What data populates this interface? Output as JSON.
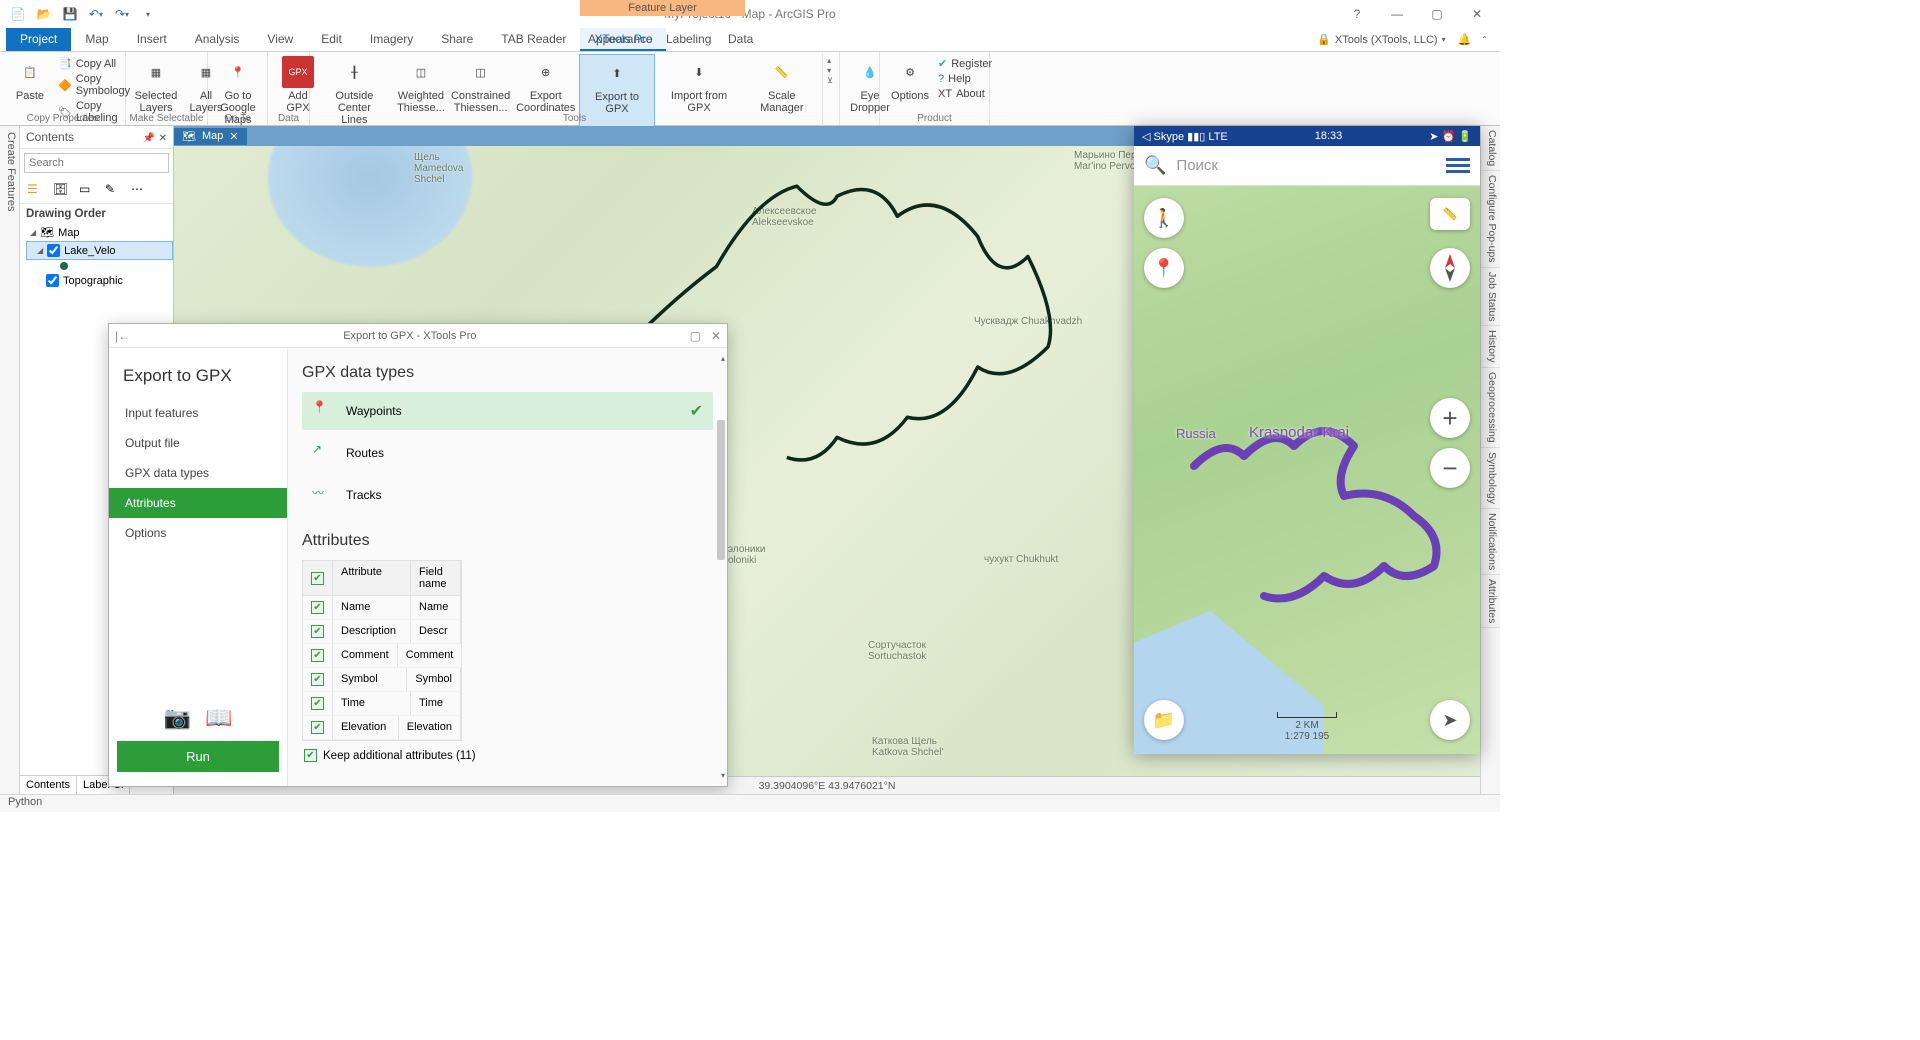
{
  "title": "MyProject10 - Map - ArcGIS Pro",
  "context_tab": "Feature Layer",
  "signin": "XTools (XTools, LLC) ",
  "ribbon_tabs": [
    "Project",
    "Map",
    "Insert",
    "Analysis",
    "View",
    "Edit",
    "Imagery",
    "Share",
    "TAB Reader",
    "XTools Pro",
    "Appearance",
    "Labeling",
    "Data"
  ],
  "ribbon": {
    "paste": "Paste",
    "copy_all": "Copy All",
    "copy_symbology": "Copy Symbology",
    "copy_labeling": "Copy Labeling",
    "copy_props_group": "Copy Properties",
    "selected_layers": "Selected\nLayers",
    "all_layers": "All\nLayers",
    "make_selectable_group": "Make Selectable",
    "goto_google": "Go to Google\nMaps ",
    "goto_group": "Go To",
    "add_gpx": "Add\nGPX",
    "data_group": "Data",
    "outside_center": "Outside Center\nLines",
    "weighted": "Weighted\nThiesse...",
    "constrained": "Constrained\nThiessen...",
    "export_coords": "Export\nCoordinates",
    "export_gpx": "Export to GPX",
    "import_gpx": "Import from GPX",
    "scale_mgr": "Scale Manager",
    "tools_group": "Tools",
    "eye_dropper": "Eye\nDropper",
    "options": "Options",
    "register": "Register",
    "help": "Help",
    "about": "About",
    "product_group": "Product"
  },
  "contents": {
    "title": "Contents",
    "search_ph": "Search",
    "drawing_order": "Drawing Order",
    "map": "Map",
    "layer1": "Lake_Velo",
    "layer2": "Topographic",
    "tab1": "Contents",
    "tab2": "Label Cl"
  },
  "left_vtab": "Create Features",
  "right_vtabs": [
    "Catalog",
    "Configure Pop-ups",
    "Job Status",
    "History",
    "Geoprocessing",
    "Symbology",
    "Notifications",
    "Attributes"
  ],
  "map_tab": "Map",
  "map_labels": {
    "shchel": "Щель\nMamedova\nShchel",
    "alekseevskoe": "Алексеевское\nAlekseevskoe",
    "marino": "Марьино Первое\nMar'ino Pervoe",
    "chuakh": "Чусквадж Chuakhvadzh",
    "soloniki": "элоники\noloniki",
    "chukhukt": "чухукт Chukhukt",
    "sortu": "Сортучасток\nSortuchastok",
    "katkova": "Каткова Щель\nKatkova Shchel'"
  },
  "coordinates": "39.3904096°E 43.9476021°N",
  "dialog": {
    "title": "Export to GPX  -  XTools Pro",
    "heading": "Export to GPX",
    "steps": [
      "Input features",
      "Output file",
      "GPX data types",
      "Attributes",
      "Options"
    ],
    "section1": "GPX data types",
    "types": [
      "Waypoints",
      "Routes",
      "Tracks"
    ],
    "section2": "Attributes",
    "hdr_attr": "Attribute",
    "hdr_field": "Field name",
    "rows": [
      {
        "a": "Name",
        "f": "Name"
      },
      {
        "a": "Description",
        "f": "Descr"
      },
      {
        "a": "Comment",
        "f": "Comment"
      },
      {
        "a": "Symbol",
        "f": "Symbol"
      },
      {
        "a": "Time",
        "f": "Time"
      },
      {
        "a": "Elevation",
        "f": "Elevation"
      }
    ],
    "keep": "Keep additional attributes (11)",
    "run": "Run"
  },
  "phone": {
    "status_left": "◁ Skype",
    "signal": "LTE",
    "time": "18:33",
    "search": "Поиск",
    "label_russia": "Russia",
    "label_krai": "Krasnodar Krai",
    "scale_dist": "2 KM",
    "scale_ratio": "1:279 195"
  },
  "statusbar": "Python"
}
